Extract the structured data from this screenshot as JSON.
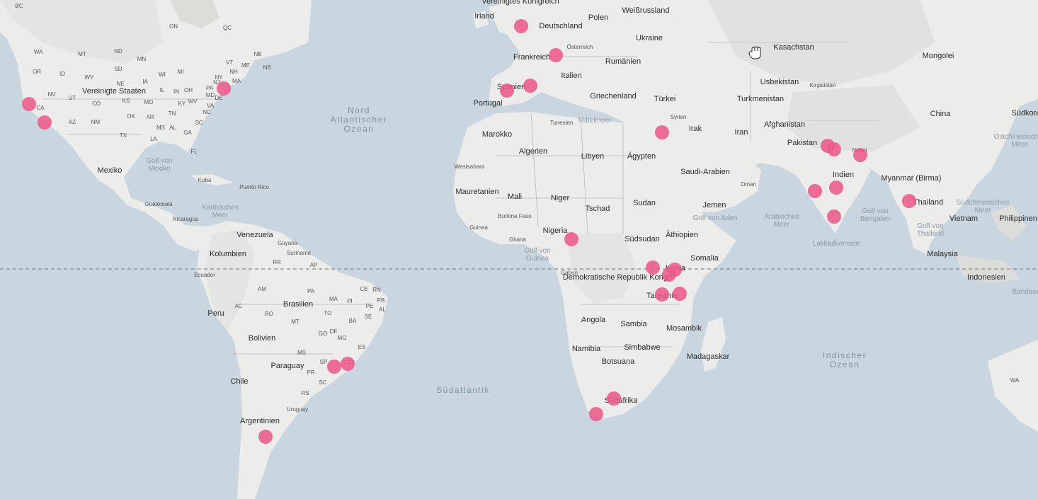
{
  "map": {
    "labels": {
      "countries": [
        "Vereinigtes Königreich",
        "Irland",
        "Deutschland",
        "Polen",
        "Weißrussland",
        "Ukraine",
        "Frankreich",
        "Österreich",
        "Rumänien",
        "Italien",
        "Spanien",
        "Portugal",
        "Griechenland",
        "Türkei",
        "Kasachstan",
        "Mongolei",
        "Usbekistan",
        "Kirgisistan",
        "Turkmenistan",
        "China",
        "Afghanistan",
        "Iran",
        "Irak",
        "Syrien",
        "Pakistan",
        "Nepal",
        "Indien",
        "Myanmar (Birma)",
        "Thailand",
        "Vietnam",
        "Philippinen",
        "Malaysia",
        "Indonesien",
        "Saudi-Arabien",
        "Oman",
        "Jemen",
        "Ägypten",
        "Libyen",
        "Algerien",
        "Tunesien",
        "Marokko",
        "Westsahara",
        "Mauretanien",
        "Mali",
        "Niger",
        "Tschad",
        "Sudan",
        "Südsudan",
        "Äthiopien",
        "Somalia",
        "Kenia",
        "Tansania",
        "Nigeria",
        "Burkina Faso",
        "Guinea",
        "Ghana",
        "Gabun",
        "Demokratische Republik Kongo",
        "Angola",
        "Sambia",
        "Mosambik",
        "Simbabwe",
        "Namibia",
        "Botsuana",
        "Südafrika",
        "Madagaskar",
        "Vereinigte Staaten",
        "Mexiko",
        "Kuba",
        "Puerto Rico",
        "Guatemala",
        "Nicaragua",
        "Venezuela",
        "Guyana",
        "Suriname",
        "Kolumbien",
        "Ecuador",
        "Peru",
        "Brasilien",
        "Bolivien",
        "Paraguay",
        "Chile",
        "Argentinien",
        "Uruguay",
        "Südkorea"
      ],
      "seas": [
        "Nord Atlantischer Ozean",
        "Südatlantik",
        "Indischer Ozean",
        "Mittelmeer",
        "Golf von Aden",
        "Arabisches Meer",
        "Golf von Bengalen",
        "Südchinesisches Meer",
        "Golf von Thailand",
        "Lakkadivensee",
        "Ostchinesisches Meer",
        "Golf von Mexiko",
        "Karibisches Meer",
        "Golf von Guinea",
        "Bandasee"
      ],
      "states": [
        "BC",
        "WA",
        "MT",
        "ND",
        "MN",
        "OR",
        "ID",
        "SD",
        "WY",
        "NE",
        "IA",
        "NV",
        "UT",
        "CO",
        "KS",
        "MO",
        "CA",
        "AZ",
        "NM",
        "OK",
        "TX",
        "AR",
        "MS",
        "AL",
        "GA",
        "LA",
        "FL",
        "IL",
        "IN",
        "OH",
        "KY",
        "TN",
        "NC",
        "SC",
        "VA",
        "WV",
        "PA",
        "NY",
        "NJ",
        "DE",
        "MD",
        "MI",
        "WI",
        "ME",
        "VT",
        "NH",
        "MA",
        "ON",
        "QC",
        "NB",
        "NS",
        "AM",
        "PA",
        "RR",
        "AP",
        "CE",
        "RN",
        "PB",
        "PE",
        "AL",
        "SE",
        "BA",
        "PI",
        "MA",
        "TO",
        "RO",
        "AC",
        "MT",
        "GO",
        "DF",
        "MG",
        "ES",
        "MS",
        "SP",
        "RJ",
        "PR",
        "SC",
        "RS",
        "WA"
      ]
    },
    "markers": [
      {
        "name": "marker-uk"
      },
      {
        "name": "marker-alps"
      },
      {
        "name": "marker-spain-madrid"
      },
      {
        "name": "marker-spain-barcelona"
      },
      {
        "name": "marker-us-northeast"
      },
      {
        "name": "marker-us-sf"
      },
      {
        "name": "marker-us-la"
      },
      {
        "name": "marker-israel"
      },
      {
        "name": "marker-pakistan-1"
      },
      {
        "name": "marker-pakistan-2"
      },
      {
        "name": "marker-nepal"
      },
      {
        "name": "marker-india-west"
      },
      {
        "name": "marker-india-central"
      },
      {
        "name": "marker-india-south"
      },
      {
        "name": "marker-thailand"
      },
      {
        "name": "marker-nigeria"
      },
      {
        "name": "marker-uganda"
      },
      {
        "name": "marker-kenya-1"
      },
      {
        "name": "marker-kenya-2"
      },
      {
        "name": "marker-tanzania-1"
      },
      {
        "name": "marker-tanzania-2"
      },
      {
        "name": "marker-brazil-sp"
      },
      {
        "name": "marker-brazil-rj"
      },
      {
        "name": "marker-argentina"
      },
      {
        "name": "marker-south-africa-1"
      },
      {
        "name": "marker-south-africa-2"
      }
    ],
    "colors": {
      "water": "#c9d6df",
      "land": "#ececeb",
      "marker": "#ec5a8a",
      "equator": "#8c8c8c"
    },
    "cursor_icon": "grab-hand-icon"
  }
}
